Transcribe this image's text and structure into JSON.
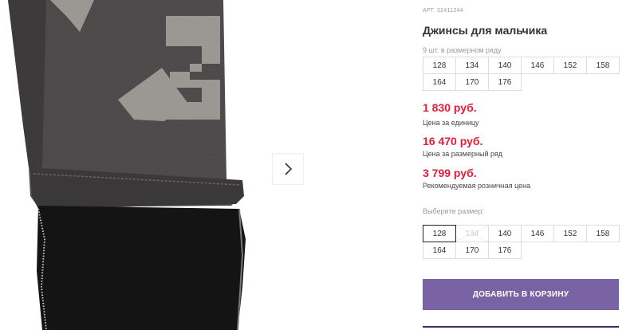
{
  "product": {
    "sku": "АРТ. 32411244",
    "title": "Джинсы для мальчика",
    "sizes_note": "9 шт. в размерном ряду",
    "range_sizes": [
      "128",
      "134",
      "140",
      "146",
      "152",
      "158",
      "164",
      "170",
      "176"
    ],
    "prices": [
      {
        "value": "1 830 руб.",
        "label": "Цена за единицу"
      },
      {
        "value": "16 470 руб.",
        "label": "Цена за размерный ряд"
      },
      {
        "value": "3 799 руб.",
        "label": "Рекомендуемая розничная цена"
      }
    ],
    "choose_label": "Выберите размер:",
    "size_options": [
      {
        "size": "128",
        "state": "selected"
      },
      {
        "size": "134",
        "state": "unavailable"
      },
      {
        "size": "140",
        "state": "available"
      },
      {
        "size": "146",
        "state": "available"
      },
      {
        "size": "152",
        "state": "available"
      },
      {
        "size": "158",
        "state": "available"
      },
      {
        "size": "164",
        "state": "available"
      },
      {
        "size": "170",
        "state": "available"
      },
      {
        "size": "176",
        "state": "available"
      }
    ],
    "add_to_cart_label": "ДОБАВИТЬ В КОРЗИНУ"
  },
  "gallery": {
    "next_icon": "chevron-right-icon"
  },
  "colors": {
    "price": "#e21d38",
    "accent": "#7a63a5"
  }
}
